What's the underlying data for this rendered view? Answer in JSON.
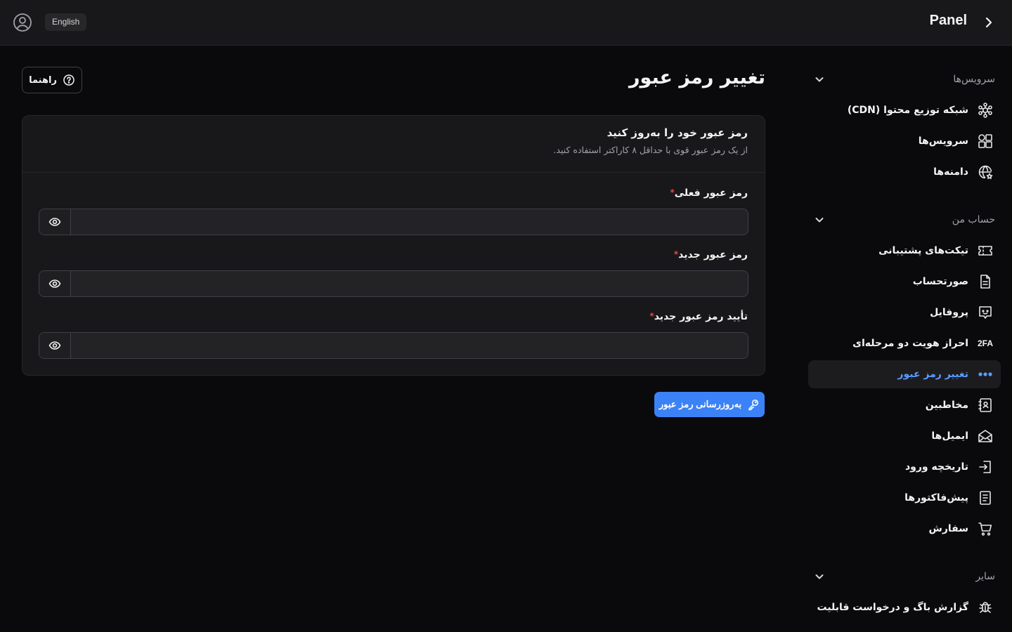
{
  "header": {
    "brand": "Panel",
    "language_button": "English",
    "icons": {
      "user": "user-circle-icon",
      "collapse": "chevron-right-icon"
    }
  },
  "sidebar": {
    "sections": [
      {
        "label": "سرویس‌ها",
        "items": [
          {
            "label": "شبکه توزیع محتوا (CDN)",
            "icon": "network-icon"
          },
          {
            "label": "سرویس‌ها",
            "icon": "shapes-icon"
          },
          {
            "label": "دامنه‌ها",
            "icon": "globe-star-icon"
          }
        ]
      },
      {
        "label": "حساب من",
        "items": [
          {
            "label": "تیکت‌های پشتیبانی",
            "icon": "ticket-icon"
          },
          {
            "label": "صورتحساب",
            "icon": "file-text-icon"
          },
          {
            "label": "پروفایل",
            "icon": "profile-message-icon"
          },
          {
            "label": "احراز هویت دو مرحله‌ای",
            "icon_text": "2FA"
          },
          {
            "label": "تغییر رمز عبور",
            "icon": "password-dots-icon",
            "active": true
          },
          {
            "label": "مخاطبین",
            "icon": "contacts-icon"
          },
          {
            "label": "ایمیل‌ها",
            "icon": "mail-open-icon"
          },
          {
            "label": "تاریخچه ورود",
            "icon": "login-icon"
          },
          {
            "label": "پیش‌فاکتورها",
            "icon": "invoice-icon"
          },
          {
            "label": "سفارش",
            "icon": "cart-icon"
          }
        ]
      },
      {
        "label": "سایر",
        "items": [
          {
            "label": "گزارش باگ و درخواست قابلیت",
            "icon": "bug-icon"
          }
        ]
      }
    ]
  },
  "main": {
    "title": "تغییر رمز عبور",
    "help_button": "راهنما",
    "card": {
      "title": "رمز عبور خود را به‌روز کنید",
      "subtitle": "از یک رمز عبور قوی با حداقل ۸ کاراکتر استفاده کنید.",
      "fields": [
        {
          "label": "رمز عبور فعلی",
          "required_mark": "*",
          "value": "",
          "placeholder": ""
        },
        {
          "label": "رمز عبور جدید",
          "required_mark": "*",
          "value": "",
          "placeholder": ""
        },
        {
          "label": "تأیید رمز عبور جدید",
          "required_mark": "*",
          "value": "",
          "placeholder": ""
        }
      ]
    },
    "submit_button": "به‌روزرسانی رمز عبور"
  },
  "colors": {
    "accent": "#3b82f6",
    "active_text": "#5b9cff",
    "required": "#ef4444",
    "background": "#0a0a0c",
    "surface": "#18181b"
  }
}
